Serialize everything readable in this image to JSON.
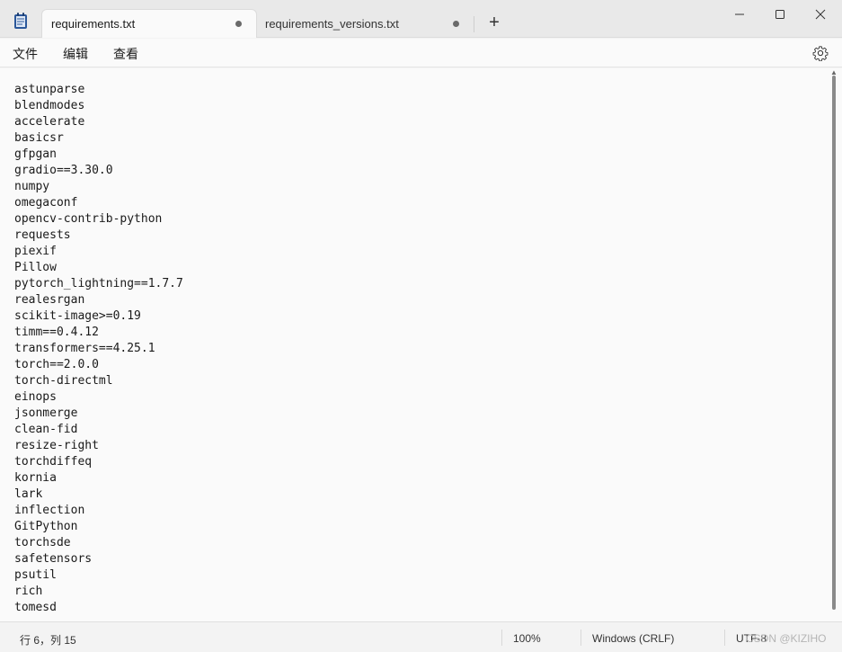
{
  "tabs": [
    {
      "label": "requirements.txt",
      "active": true,
      "unsaved": true
    },
    {
      "label": "requirements_versions.txt",
      "active": false,
      "unsaved": true
    }
  ],
  "new_tab_glyph": "+",
  "menu": {
    "file": "文件",
    "edit": "编辑",
    "view": "查看"
  },
  "editor": {
    "lines": [
      "astunparse",
      "blendmodes",
      "accelerate",
      "basicsr",
      "gfpgan",
      "gradio==3.30.0",
      "numpy",
      "omegaconf",
      "opencv-contrib-python",
      "requests",
      "piexif",
      "Pillow",
      "pytorch_lightning==1.7.7",
      "realesrgan",
      "scikit-image>=0.19",
      "timm==0.4.12",
      "transformers==4.25.1",
      "torch==2.0.0",
      "torch-directml",
      "einops",
      "jsonmerge",
      "clean-fid",
      "resize-right",
      "torchdiffeq",
      "kornia",
      "lark",
      "inflection",
      "GitPython",
      "torchsde",
      "safetensors",
      "psutil",
      "rich",
      "tomesd"
    ]
  },
  "status": {
    "position": "行 6，列 15",
    "zoom": "100%",
    "line_ending": "Windows (CRLF)",
    "encoding": "UTF-8",
    "watermark": "CSDN @KIZIHO"
  },
  "colors": {
    "accent": "#2b579a"
  }
}
